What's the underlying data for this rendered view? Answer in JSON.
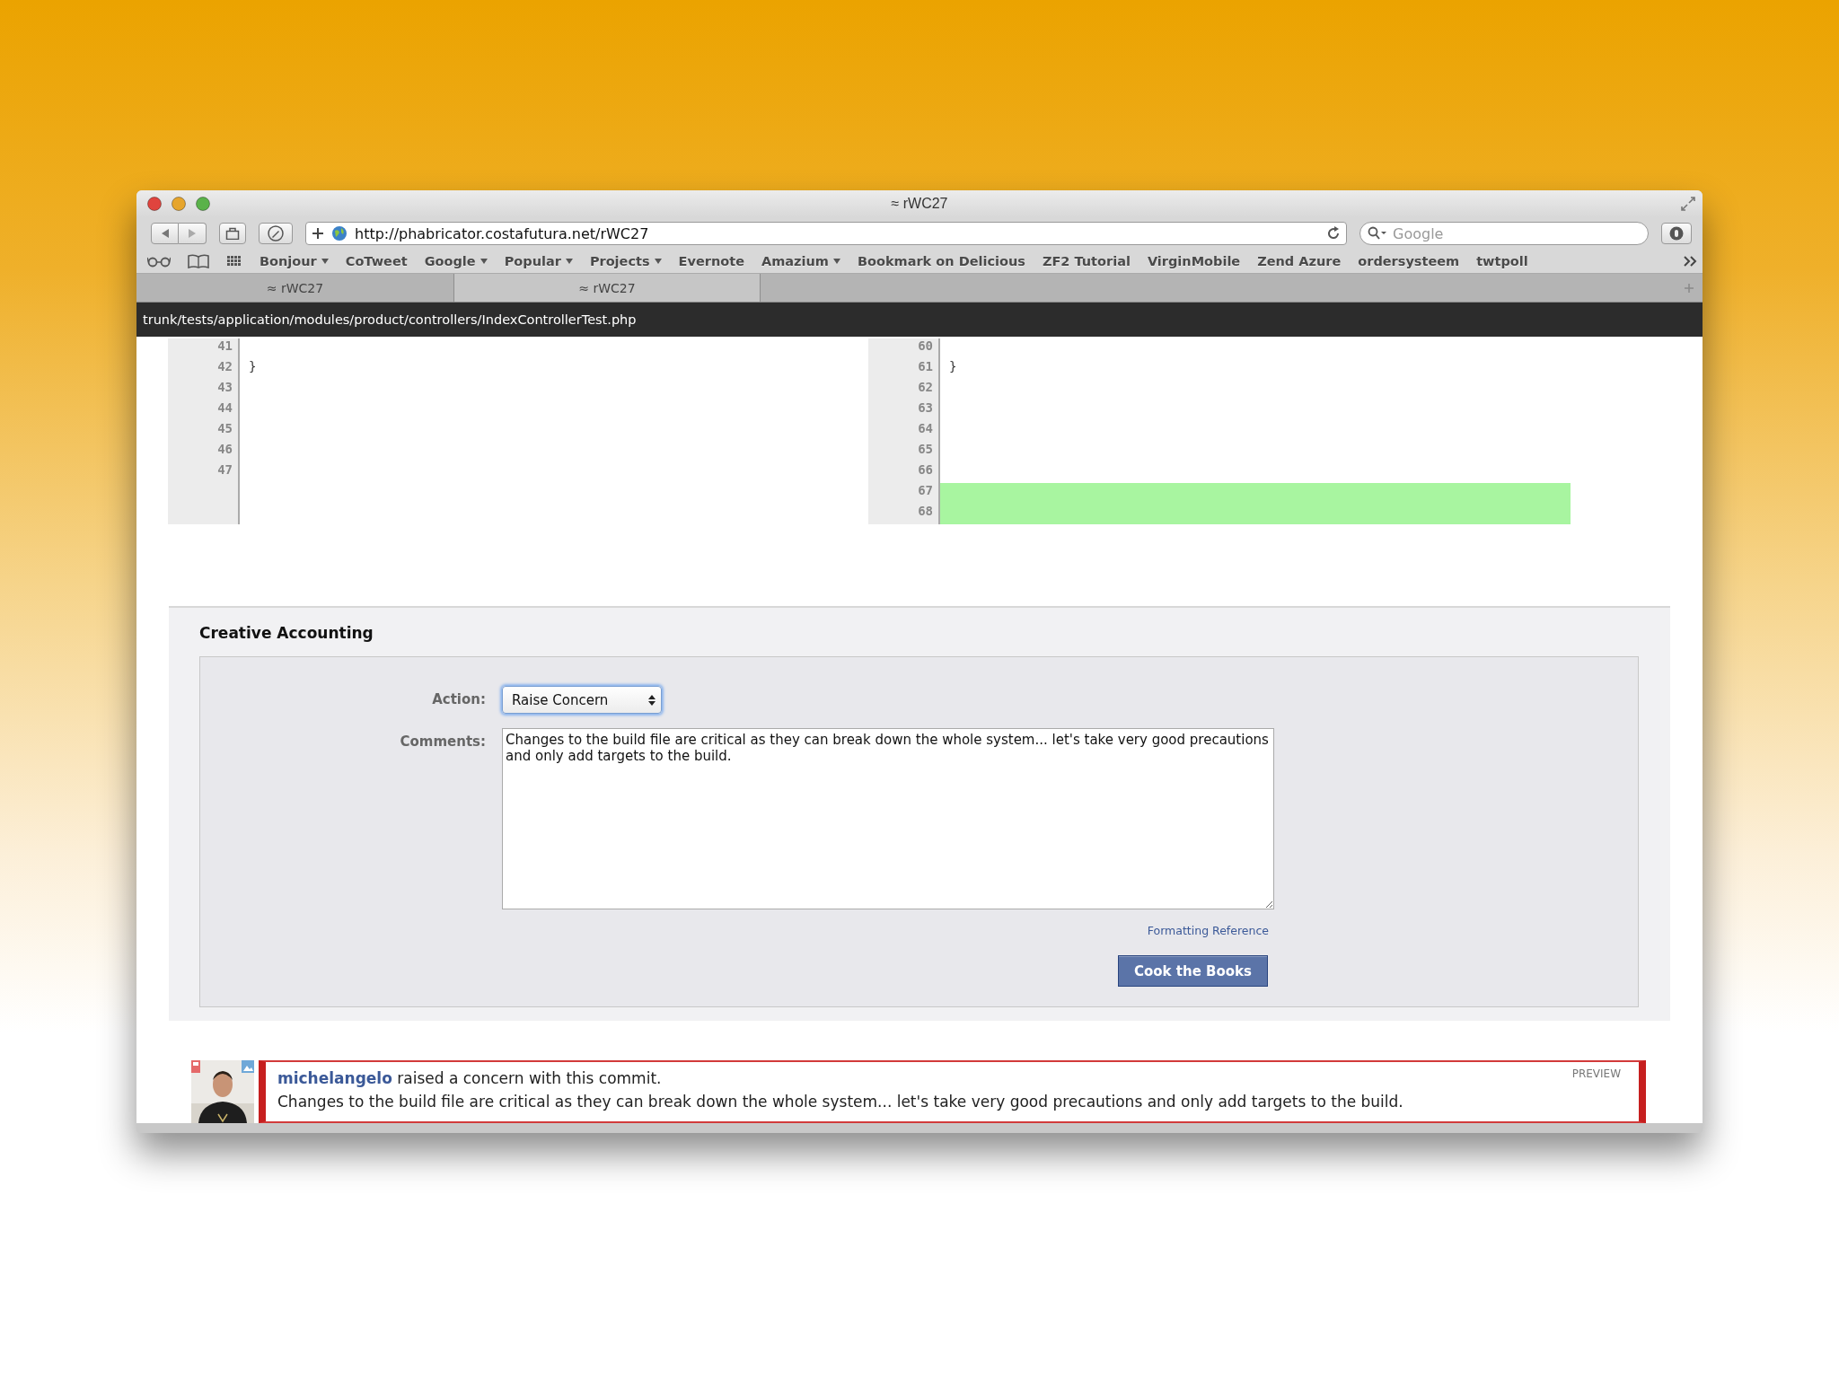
{
  "window": {
    "title": "≈ rWC27"
  },
  "toolbar": {
    "url": "http://phabricator.costafutura.net/rWC27",
    "search": {
      "placeholder": "Google"
    }
  },
  "bookmarks": [
    {
      "label": "Bonjour",
      "menu": true
    },
    {
      "label": "CoTweet",
      "menu": false
    },
    {
      "label": "Google",
      "menu": true
    },
    {
      "label": "Popular",
      "menu": true
    },
    {
      "label": "Projects",
      "menu": true
    },
    {
      "label": "Evernote",
      "menu": false
    },
    {
      "label": "Amazium",
      "menu": true
    },
    {
      "label": "Bookmark on Delicious",
      "menu": false
    },
    {
      "label": "ZF2 Tutorial",
      "menu": false
    },
    {
      "label": "VirginMobile",
      "menu": false
    },
    {
      "label": "Zend Azure",
      "menu": false
    },
    {
      "label": "ordersysteem",
      "menu": false
    },
    {
      "label": "twtpoll",
      "menu": false
    }
  ],
  "tabs": [
    {
      "label": "≈ rWC27",
      "selected": false
    },
    {
      "label": "≈ rWC27",
      "selected": true
    }
  ],
  "path_bar": "trunk/tests/application/modules/product/controllers/IndexControllerTest.php",
  "diff": {
    "left": [
      {
        "number": "41",
        "added": false
      },
      {
        "number": "42",
        "code": "}",
        "added": false
      },
      {
        "number": "43",
        "added": false
      },
      {
        "number": "44",
        "added": false
      },
      {
        "number": "45",
        "added": false
      },
      {
        "number": "46",
        "added": false
      },
      {
        "number": "47",
        "added": false
      }
    ],
    "right": [
      {
        "number": "60",
        "added": false
      },
      {
        "number": "61",
        "code": "}",
        "added": false
      },
      {
        "number": "62",
        "added": false
      },
      {
        "number": "63",
        "added": false
      },
      {
        "number": "64",
        "added": false
      },
      {
        "number": "65",
        "added": false
      },
      {
        "number": "66",
        "added": false
      },
      {
        "number": "67",
        "added": true
      },
      {
        "number": "68",
        "added": true
      }
    ]
  },
  "form": {
    "title": "Creative Accounting",
    "action_label": "Action:",
    "action_value": "Raise Concern",
    "comments_label": "Comments:",
    "comments_value": "Changes to the build file are critical as they can break down the whole system... let's take very good precautions and only add targets to the build.",
    "formatting_link": "Formatting Reference",
    "submit": "Cook the Books"
  },
  "comment": {
    "author": "michelangelo",
    "action": " raised a concern with this commit.",
    "badge": "PREVIEW",
    "body": "Changes to the build file are critical as they can break down the whole system... let's take very good precautions and only add targets to the build."
  }
}
